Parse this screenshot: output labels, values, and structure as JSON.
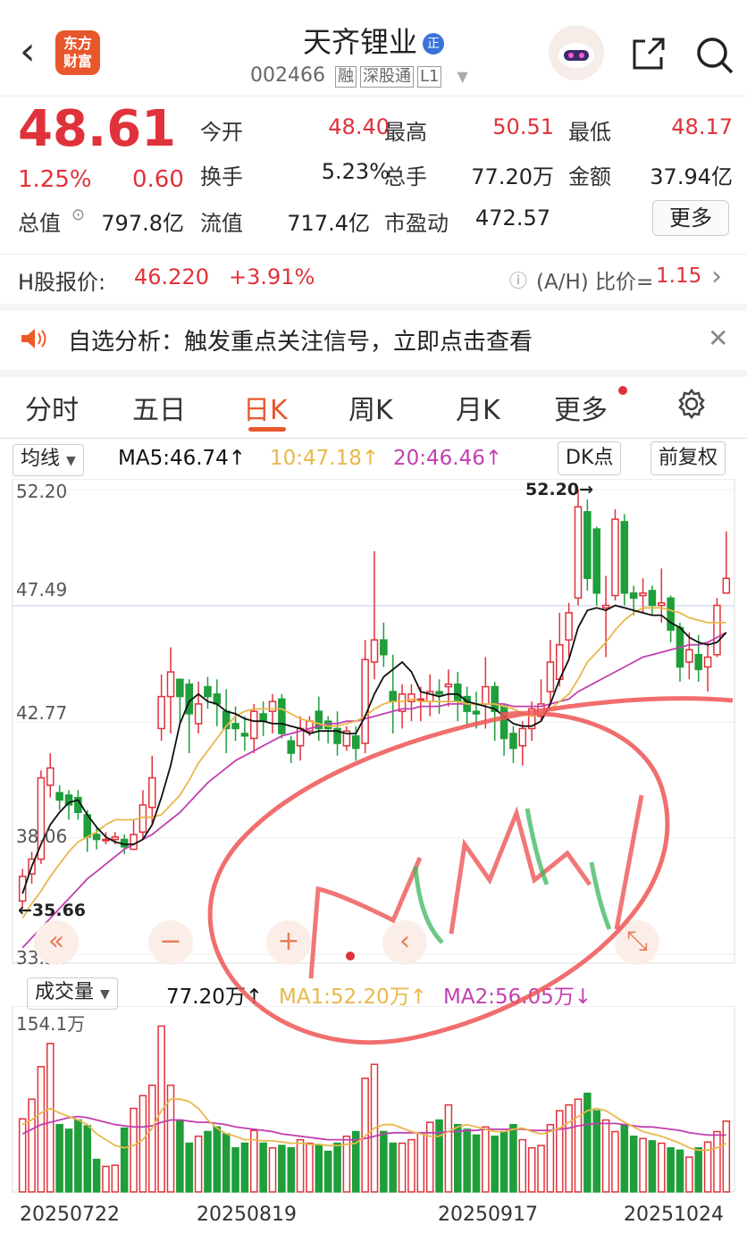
{
  "header": {
    "back": "‹",
    "logo": "东方\n财富",
    "title": "天齐锂业",
    "title_badge": "正",
    "code": "002466",
    "tags": [
      "融",
      "深股通",
      "L1"
    ]
  },
  "quote": {
    "price": "48.61",
    "change_pct": "1.25%",
    "change": "0.60",
    "rows": [
      [
        {
          "label": "今开",
          "value": "48.40",
          "color": "red"
        },
        {
          "label": "最高",
          "value": "50.51",
          "color": "red"
        },
        {
          "label": "最低",
          "value": "48.17",
          "color": "red"
        }
      ],
      [
        {
          "label": "换手",
          "value": "5.23%",
          "color": "dark"
        },
        {
          "label": "总手",
          "value": "77.20万",
          "color": "dark"
        },
        {
          "label": "金额",
          "value": "37.94亿",
          "color": "dark"
        }
      ],
      [
        {
          "label": "流值",
          "value": "717.4亿",
          "color": "dark"
        },
        {
          "label": "市盈动",
          "value": "472.57",
          "color": "dark"
        }
      ]
    ],
    "total_value_label": "总值",
    "total_value": "797.8亿",
    "more_label": "更多"
  },
  "hshare": {
    "label": "H股报价:",
    "price": "46.220",
    "pct": "+3.91%",
    "ratio_label": "(A/H) 比价=",
    "ratio": "1.15"
  },
  "notice": {
    "text": "自选分析：触发重点关注信号，立即点击查看"
  },
  "tabs": [
    "分时",
    "五日",
    "日K",
    "周K",
    "月K",
    "更多"
  ],
  "active_tab": "日K",
  "ma_bar": {
    "selector": "均线",
    "ma5": "MA5:46.74↑",
    "ma10": "10:47.18↑",
    "ma20": "20:46.46↑",
    "dk": "DK点",
    "adj": "前复权"
  },
  "vol_bar": {
    "selector": "成交量",
    "vol": "77.20万↑",
    "ma1": "MA1:52.20万↑",
    "ma2": "MA2:56.05万↓"
  },
  "colors": {
    "up": "#e0323a",
    "down": "#1f9e3a",
    "ma5": "#111111",
    "ma10": "#e8b84a",
    "ma20": "#c23fb0"
  },
  "chart_data": {
    "type": "candlestick",
    "y_ticks": [
      "52.20",
      "47.49",
      "42.77",
      "38.06",
      "33.34"
    ],
    "ylim": [
      33.34,
      52.2
    ],
    "high_marker": "52.20→",
    "low_marker": "←35.66",
    "vol_max_label": "154.1万",
    "dates": [
      "20250722",
      "20250819",
      "20250917",
      "20251024"
    ],
    "candles": [
      [
        35.5,
        36.5,
        35.2,
        36.8
      ],
      [
        36.6,
        37.2,
        36.2,
        37.5
      ],
      [
        37.2,
        40.5,
        37.0,
        40.8
      ],
      [
        40.2,
        40.9,
        39.7,
        41.5
      ],
      [
        39.9,
        39.6,
        39.2,
        40.2
      ],
      [
        39.8,
        39.4,
        38.8,
        40.0
      ],
      [
        39.7,
        39.1,
        38.8,
        40.0
      ],
      [
        39.0,
        38.1,
        37.5,
        39.2
      ],
      [
        38.2,
        38.0,
        37.6,
        38.5
      ],
      [
        38.0,
        38.0,
        37.8,
        38.3
      ],
      [
        38.0,
        38.1,
        37.8,
        38.3
      ],
      [
        38.0,
        37.7,
        37.4,
        38.2
      ],
      [
        37.6,
        38.2,
        37.6,
        38.8
      ],
      [
        38.3,
        39.4,
        38.0,
        40.0
      ],
      [
        39.3,
        40.5,
        38.6,
        41.4
      ],
      [
        42.5,
        43.8,
        42.0,
        44.7
      ],
      [
        43.8,
        44.8,
        42.3,
        45.8
      ],
      [
        44.5,
        43.8,
        42.7,
        44.4
      ],
      [
        44.3,
        43.1,
        41.5,
        44.5
      ],
      [
        42.7,
        43.5,
        42.3,
        44.4
      ],
      [
        44.2,
        43.8,
        43.3,
        44.6
      ],
      [
        43.9,
        43.5,
        42.6,
        44.5
      ],
      [
        43.2,
        42.5,
        41.5,
        44.1
      ],
      [
        42.7,
        42.5,
        42.0,
        43.4
      ],
      [
        42.3,
        42.2,
        41.6,
        43.0
      ],
      [
        42.1,
        43.2,
        41.5,
        43.5
      ],
      [
        43.1,
        42.8,
        42.2,
        43.6
      ],
      [
        43.2,
        43.6,
        42.3,
        43.9
      ],
      [
        43.7,
        42.3,
        42.1,
        43.9
      ],
      [
        42.0,
        41.5,
        41.1,
        42.2
      ],
      [
        41.8,
        42.5,
        41.2,
        43.0
      ],
      [
        42.4,
        42.8,
        42.2,
        43.0
      ],
      [
        43.2,
        42.5,
        42.0,
        43.8
      ],
      [
        42.8,
        42.5,
        41.9,
        43.0
      ],
      [
        42.5,
        41.9,
        41.4,
        43.2
      ],
      [
        41.8,
        42.4,
        41.6,
        42.6
      ],
      [
        42.2,
        41.7,
        41.2,
        42.6
      ],
      [
        41.9,
        45.3,
        41.5,
        46.1
      ],
      [
        45.2,
        46.1,
        44.5,
        49.7
      ],
      [
        46.1,
        45.5,
        45.0,
        46.8
      ],
      [
        44.0,
        43.6,
        42.3,
        45.5
      ],
      [
        43.2,
        43.9,
        42.5,
        44.3
      ],
      [
        43.6,
        43.9,
        42.8,
        44.3
      ],
      [
        43.7,
        43.7,
        42.8,
        44.2
      ],
      [
        43.6,
        44.0,
        43.0,
        44.7
      ],
      [
        44.0,
        43.9,
        43.1,
        44.5
      ],
      [
        44.2,
        44.3,
        43.4,
        44.9
      ],
      [
        44.3,
        43.6,
        42.8,
        44.8
      ],
      [
        43.8,
        43.2,
        42.6,
        44.2
      ],
      [
        43.2,
        43.1,
        42.5,
        44.0
      ],
      [
        43.5,
        44.2,
        42.5,
        45.4
      ],
      [
        44.2,
        43.2,
        42.0,
        44.4
      ],
      [
        43.4,
        42.1,
        41.4,
        43.5
      ],
      [
        42.3,
        41.7,
        41.1,
        42.6
      ],
      [
        41.8,
        42.5,
        41.0,
        42.8
      ],
      [
        42.5,
        43.3,
        42.0,
        43.6
      ],
      [
        43.0,
        43.5,
        42.8,
        44.5
      ],
      [
        44.0,
        45.2,
        43.5,
        46.1
      ],
      [
        44.5,
        45.9,
        44.2,
        47.2
      ],
      [
        46.1,
        47.2,
        45.4,
        47.6
      ],
      [
        47.8,
        51.5,
        47.5,
        52.2
      ],
      [
        51.3,
        48.6,
        48.1,
        51.8
      ],
      [
        50.6,
        48.0,
        47.5,
        50.7
      ],
      [
        47.4,
        47.5,
        45.4,
        48.7
      ],
      [
        47.9,
        51.0,
        47.7,
        51.4
      ],
      [
        50.9,
        48.0,
        47.5,
        51.2
      ],
      [
        48.0,
        47.8,
        47.1,
        48.3
      ],
      [
        47.9,
        48.0,
        47.2,
        48.6
      ],
      [
        48.1,
        47.5,
        47.1,
        48.3
      ],
      [
        47.5,
        47.6,
        46.8,
        49.0
      ],
      [
        47.8,
        46.5,
        46.0,
        47.9
      ],
      [
        46.6,
        45.0,
        44.4,
        46.8
      ],
      [
        45.2,
        45.7,
        44.5,
        46.4
      ],
      [
        45.5,
        44.9,
        44.4,
        46.3
      ],
      [
        45.0,
        45.4,
        44.0,
        46.0
      ],
      [
        45.5,
        47.5,
        45.4,
        47.8
      ],
      [
        48.0,
        48.6,
        48.0,
        50.5
      ]
    ],
    "ma5": [
      35.8,
      36.9,
      37.8,
      38.6,
      39.1,
      39.5,
      39.6,
      39.0,
      38.5,
      38.1,
      37.9,
      37.8,
      37.8,
      38.0,
      38.6,
      39.7,
      41.0,
      42.7,
      43.6,
      43.9,
      43.6,
      43.5,
      43.2,
      43.1,
      42.9,
      42.8,
      42.8,
      42.7,
      42.7,
      42.6,
      42.5,
      42.3,
      42.4,
      42.4,
      42.4,
      42.3,
      42.3,
      43.0,
      43.9,
      44.6,
      44.9,
      45.2,
      44.8,
      44.0,
      43.9,
      43.8,
      43.9,
      43.9,
      43.6,
      43.5,
      43.4,
      43.3,
      43.0,
      42.7,
      42.6,
      42.6,
      42.8,
      43.5,
      44.5,
      45.3,
      46.6,
      47.3,
      47.4,
      47.3,
      47.5,
      47.4,
      47.3,
      47.2,
      47.1,
      47.1,
      46.8,
      46.6,
      46.2,
      46.0,
      45.9,
      46.0,
      46.4
    ],
    "ma10": [
      34.8,
      35.4,
      35.9,
      36.5,
      37.0,
      37.5,
      37.9,
      38.1,
      38.3,
      38.6,
      38.8,
      38.8,
      38.8,
      38.9,
      38.9,
      39.0,
      39.4,
      39.8,
      40.4,
      41.1,
      41.6,
      42.1,
      42.6,
      43.0,
      43.2,
      43.3,
      43.3,
      43.3,
      43.3,
      43.1,
      42.9,
      42.8,
      42.7,
      42.6,
      42.6,
      42.7,
      42.8,
      43.0,
      43.3,
      43.5,
      43.6,
      43.6,
      43.7,
      43.6,
      43.6,
      43.6,
      43.6,
      43.6,
      43.5,
      43.5,
      43.5,
      43.5,
      43.4,
      43.3,
      43.1,
      43.0,
      43.1,
      43.3,
      43.6,
      43.9,
      44.5,
      45.2,
      45.6,
      46.0,
      46.5,
      46.9,
      47.2,
      47.4,
      47.4,
      47.4,
      47.3,
      47.2,
      47.0,
      46.9,
      46.8,
      46.8,
      46.8
    ],
    "ma20": [
      33.6,
      34.0,
      34.4,
      34.8,
      35.2,
      35.6,
      36.0,
      36.4,
      36.7,
      37.0,
      37.3,
      37.6,
      37.8,
      38.0,
      38.2,
      38.5,
      38.8,
      39.1,
      39.5,
      39.9,
      40.3,
      40.6,
      40.9,
      41.2,
      41.4,
      41.6,
      41.8,
      42.0,
      42.2,
      42.3,
      42.4,
      42.5,
      42.6,
      42.7,
      42.7,
      42.8,
      42.8,
      42.9,
      43.0,
      43.1,
      43.2,
      43.3,
      43.3,
      43.4,
      43.4,
      43.4,
      43.5,
      43.5,
      43.5,
      43.5,
      43.5,
      43.5,
      43.5,
      43.4,
      43.4,
      43.4,
      43.4,
      43.5,
      43.6,
      43.7,
      44.0,
      44.2,
      44.4,
      44.6,
      44.8,
      45.0,
      45.2,
      45.4,
      45.5,
      45.6,
      45.7,
      45.8,
      45.9,
      45.9,
      46.0,
      46.2,
      46.4
    ],
    "volume": [
      63,
      80,
      108,
      128,
      58,
      54,
      62,
      57,
      28,
      22,
      23,
      55,
      72,
      83,
      92,
      143,
      92,
      62,
      42,
      48,
      52,
      56,
      50,
      38,
      42,
      53,
      42,
      38,
      40,
      38,
      45,
      42,
      40,
      35,
      42,
      48,
      52,
      98,
      110,
      52,
      42,
      42,
      45,
      51,
      60,
      62,
      75,
      58,
      54,
      49,
      56,
      48,
      52,
      58,
      45,
      38,
      40,
      58,
      70,
      75,
      80,
      85,
      70,
      62,
      52,
      58,
      48,
      46,
      44,
      42,
      38,
      36,
      30,
      38,
      43,
      52,
      61
    ],
    "vol_ma1": [
      58,
      62,
      68,
      72,
      68,
      65,
      62,
      58,
      50,
      45,
      40,
      38,
      40,
      45,
      55,
      70,
      80,
      80,
      78,
      72,
      62,
      55,
      50,
      48,
      45,
      45,
      44,
      44,
      43,
      42,
      42,
      41,
      41,
      40,
      40,
      41,
      42,
      48,
      55,
      58,
      58,
      55,
      52,
      50,
      48,
      48,
      52,
      56,
      58,
      56,
      54,
      52,
      52,
      54,
      55,
      52,
      50,
      52,
      55,
      60,
      65,
      70,
      72,
      70,
      65,
      60,
      56,
      52,
      50,
      48,
      45,
      42,
      38,
      36,
      36,
      38,
      42
    ],
    "vol_ma2": [
      50,
      54,
      58,
      60,
      62,
      64,
      65,
      64,
      62,
      60,
      58,
      57,
      56,
      56,
      57,
      60,
      62,
      62,
      61,
      60,
      60,
      59,
      58,
      56,
      55,
      54,
      53,
      52,
      50,
      49,
      48,
      47,
      46,
      45,
      45,
      45,
      45,
      46,
      48,
      50,
      51,
      51,
      51,
      51,
      51,
      51,
      52,
      52,
      53,
      53,
      54,
      54,
      54,
      54,
      54,
      53,
      53,
      53,
      54,
      55,
      57,
      58,
      59,
      59,
      59,
      58,
      57,
      56,
      56,
      55,
      54,
      53,
      51,
      50,
      49,
      49,
      49
    ]
  }
}
